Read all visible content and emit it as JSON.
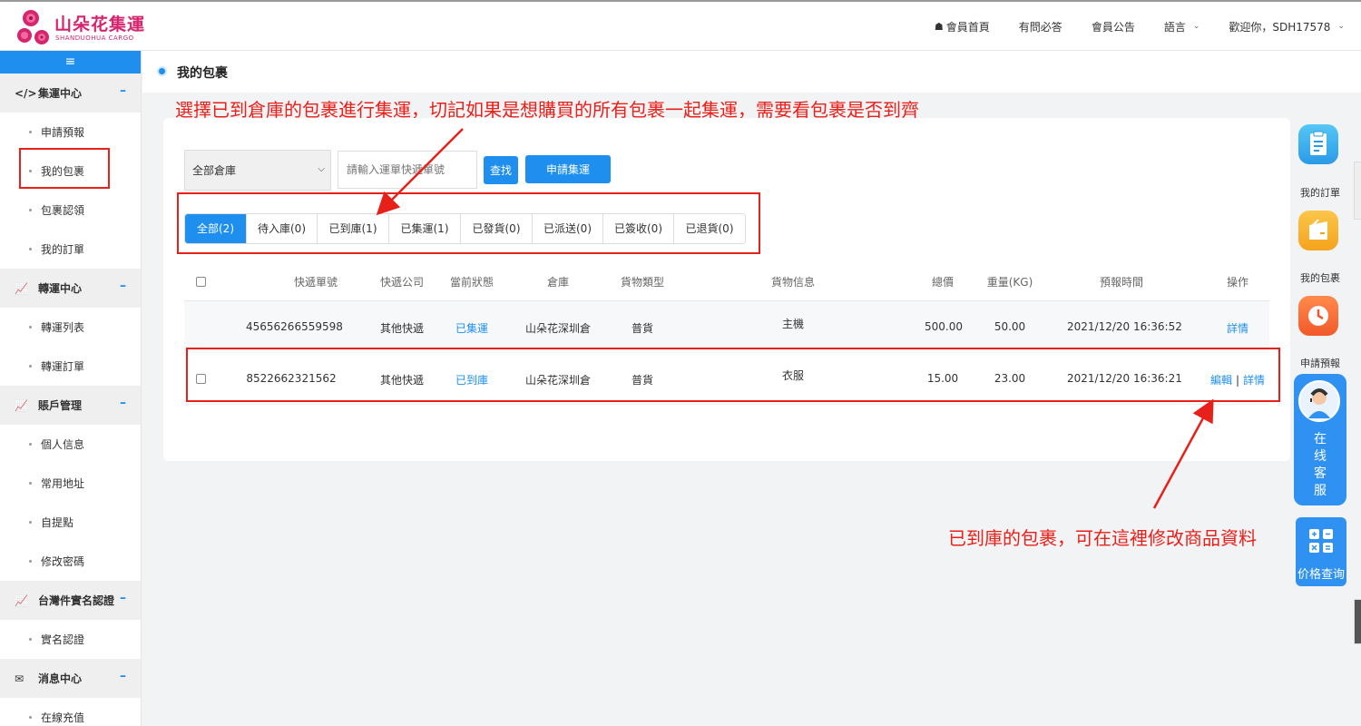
{
  "brand": {
    "name": "山朵花集運",
    "subtitle": "SHANDUOHUA CARGO"
  },
  "nav": {
    "home": "會員首頁",
    "faq": "有問必答",
    "notice": "會員公告",
    "language": "語言",
    "welcome": "歡迎你，SDH17578"
  },
  "sidebar": {
    "groups": [
      {
        "title": "集運中心",
        "items": [
          "申請預報",
          "我的包裹",
          "包裹認領",
          "我的訂單"
        ]
      },
      {
        "title": "轉運中心",
        "items": [
          "轉運列表",
          "轉運訂單"
        ]
      },
      {
        "title": "賬戶管理",
        "items": [
          "個人信息",
          "常用地址",
          "自提點",
          "修改密碼"
        ]
      },
      {
        "title": "台灣件實名認證",
        "items": [
          "實名認證"
        ]
      },
      {
        "title": "消息中心",
        "items": [
          "在線充值"
        ]
      }
    ]
  },
  "page": {
    "title": "我的包裹"
  },
  "annotations": {
    "top": "選擇已到倉庫的包裹進行集運，切記如果是想購買的所有包裹一起集運，需要看包裹是否到齊",
    "bottom": "已到庫的包裹，可在這裡修改商品資料"
  },
  "filters": {
    "warehouse_selected": "全部倉庫",
    "search_placeholder": "請輸入運單快遞單號",
    "find_label": "查找",
    "apply_label": "申請集運"
  },
  "tabs": [
    {
      "label": "全部(2)",
      "active": true
    },
    {
      "label": "待入庫(0)",
      "active": false
    },
    {
      "label": "已到庫(1)",
      "active": false
    },
    {
      "label": "已集運(1)",
      "active": false
    },
    {
      "label": "已發貨(0)",
      "active": false
    },
    {
      "label": "已派送(0)",
      "active": false
    },
    {
      "label": "已簽收(0)",
      "active": false
    },
    {
      "label": "已退貨(0)",
      "active": false
    }
  ],
  "table": {
    "columns": [
      "快遞單號",
      "快遞公司",
      "當前狀態",
      "倉庫",
      "貨物類型",
      "貨物信息",
      "總價",
      "重量(KG)",
      "預報時間",
      "操作"
    ],
    "rows": [
      {
        "tracking": "45656266559598",
        "company": "其他快遞",
        "status": "已集運",
        "warehouse": "山朵花深圳倉",
        "type": "普貨",
        "info": "主機",
        "price": "500.00",
        "weight": "50.00",
        "time": "2021/12/20 16:36:52",
        "actions": [
          "詳情"
        ],
        "checkbox": false
      },
      {
        "tracking": "8522662321562",
        "company": "其他快遞",
        "status": "已到庫",
        "warehouse": "山朵花深圳倉",
        "type": "普貨",
        "info": "衣服",
        "price": "15.00",
        "weight": "23.00",
        "time": "2021/12/20 16:36:21",
        "actions": [
          "編輯",
          "詳情"
        ],
        "checkbox": true
      }
    ]
  },
  "right_bar": {
    "orders_label": "我的訂單",
    "parcels_label": "我的包裹",
    "forecast_label": "申請預報",
    "service_label": [
      "在",
      "线",
      "客",
      "服"
    ],
    "price_label": "价格查询"
  },
  "colors": {
    "primary": "#1e8fee",
    "annotation": "#e8201a",
    "brand": "#d6246e"
  }
}
